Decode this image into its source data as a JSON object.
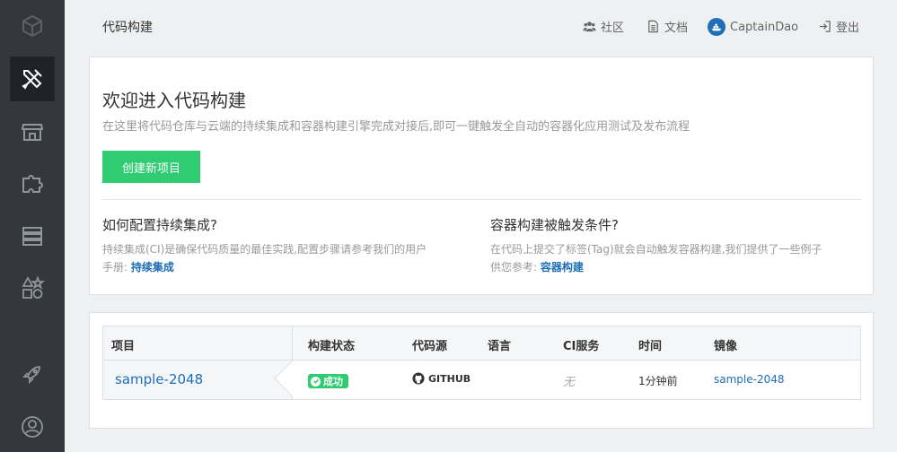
{
  "sidebar": {
    "items": [
      {
        "name": "logo-icon"
      },
      {
        "name": "tools-icon",
        "active": true
      },
      {
        "name": "store-icon"
      },
      {
        "name": "puzzle-icon"
      },
      {
        "name": "server-icon"
      },
      {
        "name": "shapes-icon"
      },
      {
        "name": "rocket-icon"
      },
      {
        "name": "user-circle-icon"
      }
    ]
  },
  "header": {
    "title": "代码构建",
    "nav": {
      "community": "社区",
      "docs": "文档",
      "username": "CaptainDao",
      "logout": "登出"
    }
  },
  "welcome": {
    "title": "欢迎进入代码构建",
    "subtitle": "在这里将代码仓库与云端的持续集成和容器构建引擎完成对接后,即可一键触发全自动的容器化应用测试及发布流程",
    "create_button": "创建新项目",
    "faq": [
      {
        "title": "如何配置持续集成?",
        "body_line1": "持续集成(CI)是确保代码质量的最佳实践,配置步骤请参考我们的用户",
        "body_line2": "手册:",
        "link": "持续集成"
      },
      {
        "title": "容器构建被触发条件?",
        "body_line1": "在代码上提交了标签(Tag)就会自动触发容器构建,我们提供了一些例子",
        "body_line2": "供您参考:",
        "link": "容器构建"
      }
    ]
  },
  "projects_table": {
    "headers": {
      "project": "项目",
      "build_status": "构建状态",
      "source": "代码源",
      "language": "语言",
      "ci_service": "CI服务",
      "time": "时间",
      "image": "镜像"
    },
    "rows": [
      {
        "project": "sample-2048",
        "build_status": "成功",
        "source": "GITHUB",
        "language": "",
        "ci_service": "无",
        "time": "1分钟前",
        "image": "sample-2048"
      }
    ]
  },
  "colors": {
    "sidebar_bg": "#34383c",
    "accent_green": "#2fcc71",
    "link_blue": "#1e6fb6"
  }
}
